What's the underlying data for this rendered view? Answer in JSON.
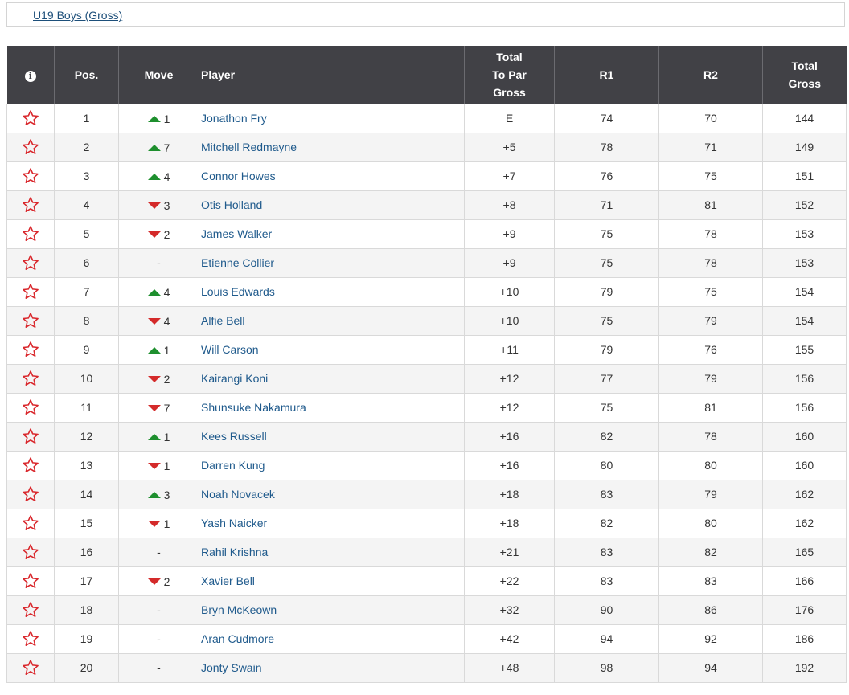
{
  "division_tab": {
    "label": "U19 Boys (Gross)"
  },
  "columns": {
    "info": "i",
    "pos": "Pos.",
    "move": "Move",
    "player": "Player",
    "to_par_l1": "Total",
    "to_par_l2": "To Par",
    "to_par_l3": "Gross",
    "r1": "R1",
    "r2": "R2",
    "total_l1": "Total",
    "total_l2": "Gross"
  },
  "colors": {
    "header_bg": "#414146",
    "up": "#1e8f2e",
    "down": "#d42a2a",
    "star": "#d9262b",
    "link": "#1f5a8c"
  },
  "rows": [
    {
      "pos": "1",
      "dir": "up",
      "move": "1",
      "player": "Jonathon Fry",
      "to_par": "E",
      "r1": "74",
      "r2": "70",
      "total": "144"
    },
    {
      "pos": "2",
      "dir": "up",
      "move": "7",
      "player": "Mitchell Redmayne",
      "to_par": "+5",
      "r1": "78",
      "r2": "71",
      "total": "149"
    },
    {
      "pos": "3",
      "dir": "up",
      "move": "4",
      "player": "Connor Howes",
      "to_par": "+7",
      "r1": "76",
      "r2": "75",
      "total": "151"
    },
    {
      "pos": "4",
      "dir": "down",
      "move": "3",
      "player": "Otis Holland",
      "to_par": "+8",
      "r1": "71",
      "r2": "81",
      "total": "152"
    },
    {
      "pos": "5",
      "dir": "down",
      "move": "2",
      "player": "James Walker",
      "to_par": "+9",
      "r1": "75",
      "r2": "78",
      "total": "153"
    },
    {
      "pos": "6",
      "dir": "none",
      "move": "-",
      "player": "Etienne Collier",
      "to_par": "+9",
      "r1": "75",
      "r2": "78",
      "total": "153"
    },
    {
      "pos": "7",
      "dir": "up",
      "move": "4",
      "player": "Louis Edwards",
      "to_par": "+10",
      "r1": "79",
      "r2": "75",
      "total": "154"
    },
    {
      "pos": "8",
      "dir": "down",
      "move": "4",
      "player": "Alfie Bell",
      "to_par": "+10",
      "r1": "75",
      "r2": "79",
      "total": "154"
    },
    {
      "pos": "9",
      "dir": "up",
      "move": "1",
      "player": "Will Carson",
      "to_par": "+11",
      "r1": "79",
      "r2": "76",
      "total": "155"
    },
    {
      "pos": "10",
      "dir": "down",
      "move": "2",
      "player": "Kairangi Koni",
      "to_par": "+12",
      "r1": "77",
      "r2": "79",
      "total": "156"
    },
    {
      "pos": "11",
      "dir": "down",
      "move": "7",
      "player": "Shunsuke Nakamura",
      "to_par": "+12",
      "r1": "75",
      "r2": "81",
      "total": "156"
    },
    {
      "pos": "12",
      "dir": "up",
      "move": "1",
      "player": "Kees Russell",
      "to_par": "+16",
      "r1": "82",
      "r2": "78",
      "total": "160"
    },
    {
      "pos": "13",
      "dir": "down",
      "move": "1",
      "player": "Darren Kung",
      "to_par": "+16",
      "r1": "80",
      "r2": "80",
      "total": "160"
    },
    {
      "pos": "14",
      "dir": "up",
      "move": "3",
      "player": "Noah Novacek",
      "to_par": "+18",
      "r1": "83",
      "r2": "79",
      "total": "162"
    },
    {
      "pos": "15",
      "dir": "down",
      "move": "1",
      "player": "Yash Naicker",
      "to_par": "+18",
      "r1": "82",
      "r2": "80",
      "total": "162"
    },
    {
      "pos": "16",
      "dir": "none",
      "move": "-",
      "player": "Rahil Krishna",
      "to_par": "+21",
      "r1": "83",
      "r2": "82",
      "total": "165"
    },
    {
      "pos": "17",
      "dir": "down",
      "move": "2",
      "player": "Xavier Bell",
      "to_par": "+22",
      "r1": "83",
      "r2": "83",
      "total": "166"
    },
    {
      "pos": "18",
      "dir": "none",
      "move": "-",
      "player": "Bryn McKeown",
      "to_par": "+32",
      "r1": "90",
      "r2": "86",
      "total": "176"
    },
    {
      "pos": "19",
      "dir": "none",
      "move": "-",
      "player": "Aran Cudmore",
      "to_par": "+42",
      "r1": "94",
      "r2": "92",
      "total": "186"
    },
    {
      "pos": "20",
      "dir": "none",
      "move": "-",
      "player": "Jonty Swain",
      "to_par": "+48",
      "r1": "98",
      "r2": "94",
      "total": "192"
    }
  ]
}
